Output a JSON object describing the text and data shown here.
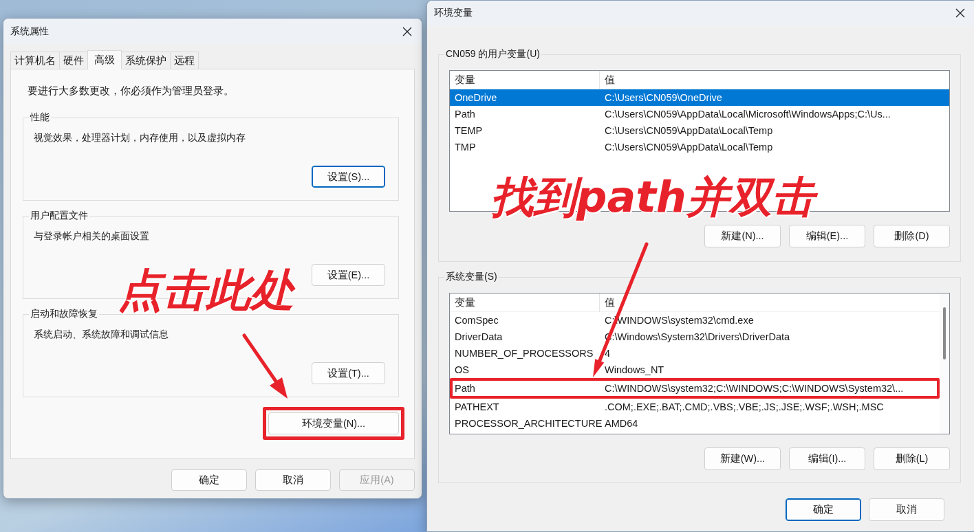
{
  "system_properties": {
    "title": "系统属性",
    "tabs": [
      {
        "label": "计算机名",
        "selected": false
      },
      {
        "label": "硬件",
        "selected": false
      },
      {
        "label": "高级",
        "selected": true
      },
      {
        "label": "系统保护",
        "selected": false
      },
      {
        "label": "远程",
        "selected": false
      }
    ],
    "notice": "要进行大多数更改，你必须作为管理员登录。",
    "groups": [
      {
        "title": "性能",
        "description": "视觉效果，处理器计划，内存使用，以及虚拟内存",
        "button": "设置(S)...",
        "focused": true
      },
      {
        "title": "用户配置文件",
        "description": "与登录帐户相关的桌面设置",
        "button": "设置(E)...",
        "focused": false
      },
      {
        "title": "启动和故障恢复",
        "description": "系统启动、系统故障和调试信息",
        "button": "设置(T)...",
        "focused": false
      }
    ],
    "env_button": {
      "label": "环境变量(N)...",
      "highlighted": true
    },
    "buttons": [
      {
        "label": "确定",
        "disabled": false
      },
      {
        "label": "取消",
        "disabled": false
      },
      {
        "label": "应用(A)",
        "disabled": true
      }
    ]
  },
  "environment_variables": {
    "title": "环境变量",
    "sections": [
      {
        "title": "CN059 的用户变量(U)",
        "columns": [
          "变量",
          "值"
        ],
        "rows": [
          {
            "name": "OneDrive",
            "value": "C:\\Users\\CN059\\OneDrive",
            "selected": true,
            "highlighted": false
          },
          {
            "name": "Path",
            "value": "C:\\Users\\CN059\\AppData\\Local\\Microsoft\\WindowsApps;C:\\Us...",
            "selected": false,
            "highlighted": false
          },
          {
            "name": "TEMP",
            "value": "C:\\Users\\CN059\\AppData\\Local\\Temp",
            "selected": false,
            "highlighted": false
          },
          {
            "name": "TMP",
            "value": "C:\\Users\\CN059\\AppData\\Local\\Temp",
            "selected": false,
            "highlighted": false
          }
        ],
        "buttons": [
          "新建(N)...",
          "编辑(E)...",
          "删除(D)"
        ],
        "scrollbar": false
      },
      {
        "title": "系统变量(S)",
        "columns": [
          "变量",
          "值"
        ],
        "rows": [
          {
            "name": "ComSpec",
            "value": "C:\\WINDOWS\\system32\\cmd.exe",
            "selected": false,
            "highlighted": false
          },
          {
            "name": "DriverData",
            "value": "C:\\Windows\\System32\\Drivers\\DriverData",
            "selected": false,
            "highlighted": false
          },
          {
            "name": "NUMBER_OF_PROCESSORS",
            "value": "4",
            "selected": false,
            "highlighted": false
          },
          {
            "name": "OS",
            "value": "Windows_NT",
            "selected": false,
            "highlighted": false
          },
          {
            "name": "Path",
            "value": "C:\\WINDOWS\\system32;C:\\WINDOWS;C:\\WINDOWS\\System32\\...",
            "selected": false,
            "highlighted": true
          },
          {
            "name": "PATHEXT",
            "value": ".COM;.EXE;.BAT;.CMD;.VBS;.VBE;.JS;.JSE;.WSF;.WSH;.MSC",
            "selected": false,
            "highlighted": false
          },
          {
            "name": "PROCESSOR_ARCHITECTURE",
            "value": "AMD64",
            "selected": false,
            "highlighted": false
          }
        ],
        "buttons": [
          "新建(W)...",
          "编辑(I)...",
          "删除(L)"
        ],
        "scrollbar": true
      }
    ],
    "buttons": [
      {
        "label": "确定",
        "default": true
      },
      {
        "label": "取消",
        "default": false
      }
    ]
  },
  "callouts": [
    {
      "text": "点击此处"
    },
    {
      "text": "找到path并双击"
    }
  ]
}
